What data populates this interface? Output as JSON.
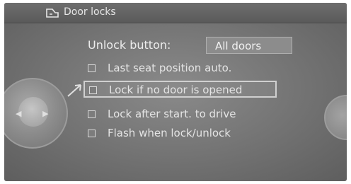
{
  "header": {
    "title": "Door locks",
    "icon": "car-door-icon"
  },
  "unlock_button": {
    "label": "Unlock button:",
    "value": "All doors"
  },
  "options": [
    {
      "label": "Last seat position auto.",
      "checked": false
    },
    {
      "label": "Lock if no door is opened",
      "checked": false,
      "selected": true
    },
    {
      "label": "Lock after start. to drive",
      "checked": false
    },
    {
      "label": "Flash when lock/unlock",
      "checked": false
    }
  ]
}
